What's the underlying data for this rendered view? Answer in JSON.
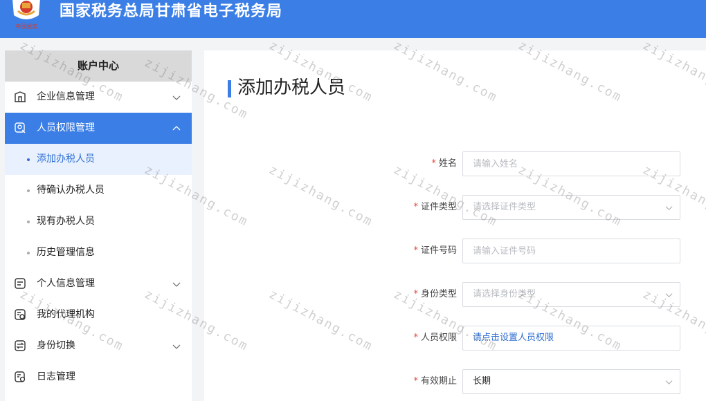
{
  "header": {
    "logo_text": "中国税务",
    "title": "国家税务总局甘肃省电子税务局"
  },
  "sidebar": {
    "title": "账户中心",
    "items": [
      {
        "label": "企业信息管理",
        "icon": "building-icon"
      },
      {
        "label": "人员权限管理",
        "icon": "user-permission-icon",
        "active": true
      },
      {
        "label": "个人信息管理",
        "icon": "profile-card-icon"
      },
      {
        "label": "我的代理机构",
        "icon": "agency-icon"
      },
      {
        "label": "身份切换",
        "icon": "switch-icon"
      },
      {
        "label": "日志管理",
        "icon": "log-icon"
      }
    ],
    "subitems": [
      {
        "label": "添加办税人员",
        "active": true
      },
      {
        "label": "待确认办税人员"
      },
      {
        "label": "现有办税人员"
      },
      {
        "label": "历史管理信息"
      }
    ]
  },
  "main": {
    "title": "添加办税人员",
    "form": {
      "name": {
        "label": "姓名",
        "placeholder": "请输入姓名"
      },
      "id_type": {
        "label": "证件类型",
        "placeholder": "请选择证件类型"
      },
      "id_number": {
        "label": "证件号码",
        "placeholder": "请输入证件号码"
      },
      "identity_type": {
        "label": "身份类型",
        "placeholder": "请选择身份类型"
      },
      "permissions": {
        "label": "人员权限",
        "link_text": "请点击设置人员权限"
      },
      "validity": {
        "label": "有效期止",
        "value": "长期"
      }
    }
  },
  "watermark": "zijizhang.com",
  "colors": {
    "accent": "#3b7fe6",
    "required": "#e5483b",
    "link": "#2f6fd3"
  }
}
